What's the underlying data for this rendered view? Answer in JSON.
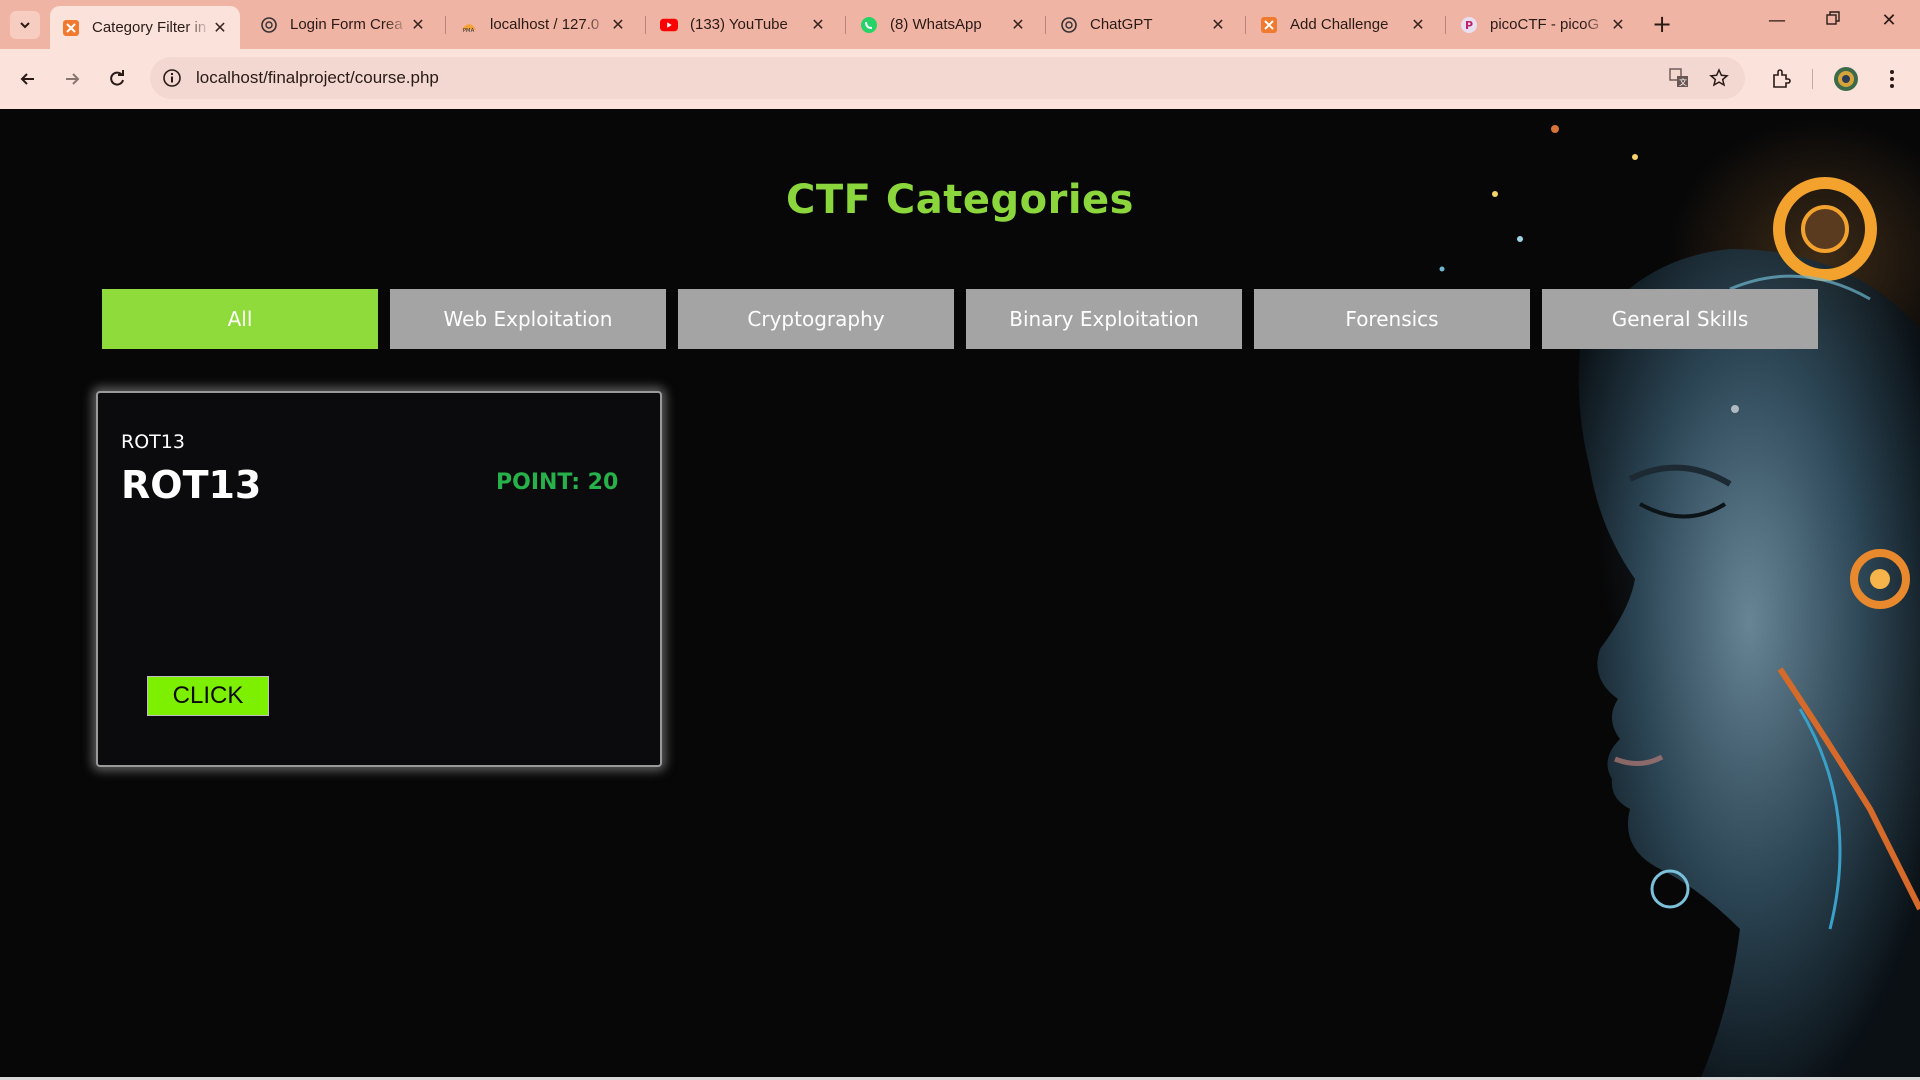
{
  "browser": {
    "tabs": [
      {
        "title": "Category Filter in",
        "icon": "xampp-icon",
        "active": true
      },
      {
        "title": "Login Form Crea",
        "icon": "chatgpt-icon",
        "active": false
      },
      {
        "title": "localhost / 127.0",
        "icon": "phpmyadmin-icon",
        "active": false
      },
      {
        "title": "(133) YouTube",
        "icon": "youtube-icon",
        "active": false
      },
      {
        "title": "(8) WhatsApp",
        "icon": "whatsapp-icon",
        "active": false
      },
      {
        "title": "ChatGPT",
        "icon": "chatgpt-icon",
        "active": false
      },
      {
        "title": "Add Challenge",
        "icon": "xampp-icon",
        "active": false
      },
      {
        "title": "picoCTF - picoG",
        "icon": "picoctf-icon",
        "active": false
      }
    ],
    "url": "localhost/finalproject/course.php",
    "colors": {
      "frame": "#f0b4a4",
      "toolbar": "#fbe3dc"
    }
  },
  "page": {
    "title": "CTF Categories",
    "filters": [
      {
        "label": "All",
        "active": true
      },
      {
        "label": "Web Exploitation",
        "active": false
      },
      {
        "label": "Cryptography",
        "active": false
      },
      {
        "label": "Binary Exploitation",
        "active": false
      },
      {
        "label": "Forensics",
        "active": false
      },
      {
        "label": "General Skills",
        "active": false
      }
    ],
    "challenge": {
      "category": "ROT13",
      "title": "ROT13",
      "points": "POINT: 20",
      "button": "CLICK"
    },
    "colors": {
      "accent": "#8fdb3b",
      "points": "#27b14a",
      "button": "#7cf000",
      "inactive_filter": "#a4a4a4"
    }
  }
}
